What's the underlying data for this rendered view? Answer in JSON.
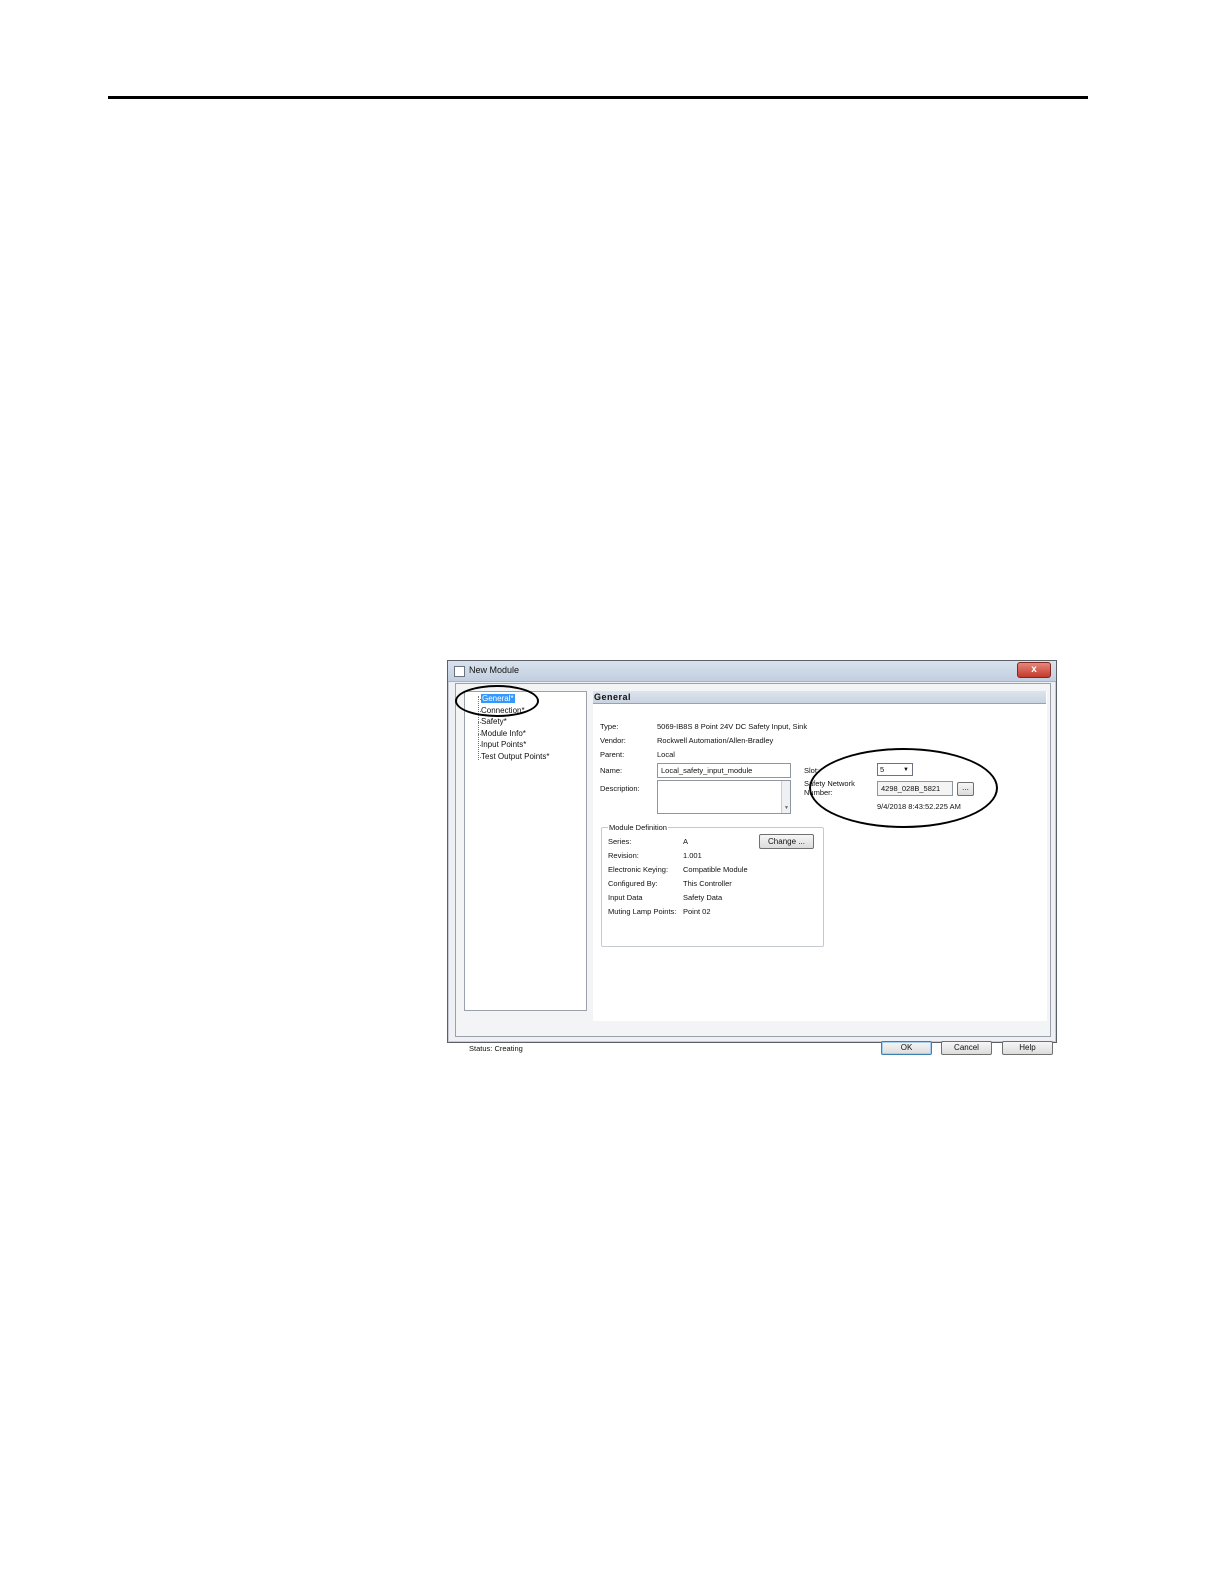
{
  "dialog": {
    "title": "New Module",
    "close_glyph": "x"
  },
  "tree": {
    "items": [
      {
        "label": "General*"
      },
      {
        "label": "Connection*"
      },
      {
        "label": "Safety*"
      },
      {
        "label": "Module Info*"
      },
      {
        "label": "Input Points*"
      },
      {
        "label": "Test Output Points*"
      }
    ]
  },
  "general": {
    "header": "General",
    "type_label": "Type:",
    "type_value": "5069-IB8S 8 Point 24V DC Safety Input, Sink",
    "vendor_label": "Vendor:",
    "vendor_value": "Rockwell Automation/Allen-Bradley",
    "parent_label": "Parent:",
    "parent_value": "Local",
    "name_label": "Name:",
    "name_value": "Local_safety_input_module",
    "description_label": "Description:",
    "description_value": "",
    "slot_label": "Slot:",
    "slot_value": "5",
    "safety_network_label_1": "Safety Network",
    "safety_network_label_2": "Number:",
    "safety_network_value": "4298_028B_5821",
    "safety_network_button": "...",
    "timestamp": "9/4/2018 8:43:52.225 AM"
  },
  "module_definition": {
    "title": "Module Definition",
    "series_label": "Series:",
    "series_value": "A",
    "revision_label": "Revision:",
    "revision_value": "1.001",
    "keying_label": "Electronic Keying:",
    "keying_value": "Compatible Module",
    "configured_label": "Configured By:",
    "configured_value": "This Controller",
    "input_data_label": "Input Data",
    "input_data_value": "Safety Data",
    "muting_label": "Muting Lamp Points:",
    "muting_value": "Point 02",
    "change_button": "Change ..."
  },
  "footer": {
    "status_label": "Status:",
    "status_value": "Creating",
    "ok_button": "OK",
    "cancel_button": "Cancel",
    "help_button": "Help"
  }
}
